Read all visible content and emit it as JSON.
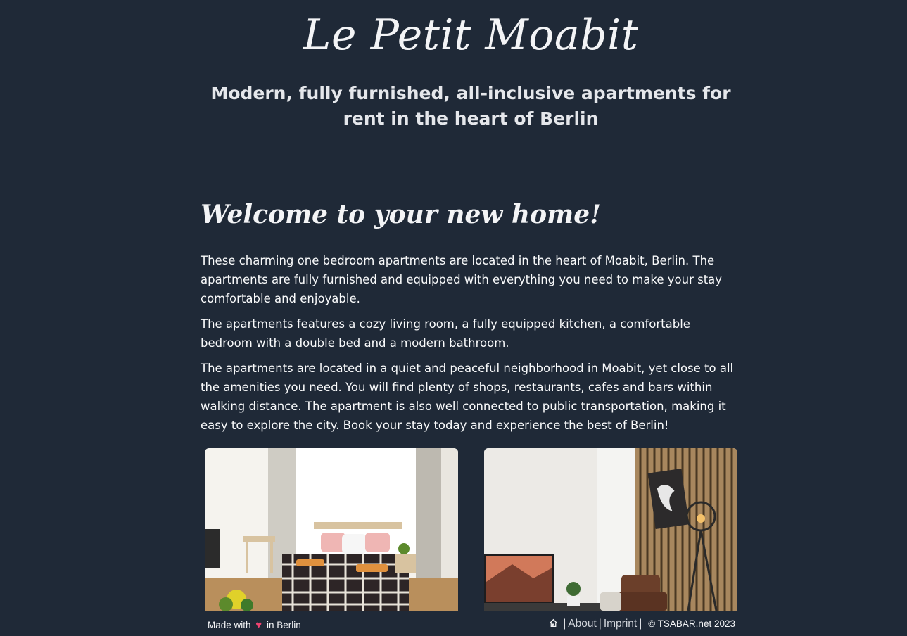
{
  "header": {
    "title": "Le Petit Moabit",
    "tagline": "Modern, fully furnished, all-inclusive apartments for rent in the heart of Berlin"
  },
  "main": {
    "heading": "Welcome to your new home!",
    "paragraphs": [
      "These charming one bedroom apartments are located in the heart of Moabit, Berlin. The apartments are fully furnished and equipped with everything you need to make your stay comfortable and enjoyable.",
      "The apartments features a cozy living room, a fully equipped kitchen, a comfortable bedroom with a double bed and a modern bathroom.",
      "The apartments are located in a quiet and peaceful neighborhood in Moabit, yet close to all the amenities you need. You will find plenty of shops, restaurants, cafes and bars within walking distance. The apartment is also well connected to public transportation, making it easy to explore the city. Book your stay today and experience the best of Berlin!"
    ]
  },
  "footer": {
    "made_with": "Made with",
    "in_city": "in Berlin",
    "home_icon": "home-icon",
    "about": "About",
    "imprint": "Imprint",
    "copyright": "© TSABAR.net 2023",
    "heart_icon": "heart-icon",
    "heart_color": "#ef4370"
  },
  "colors": {
    "background": "#1f2937",
    "text": "#e5e7eb"
  }
}
